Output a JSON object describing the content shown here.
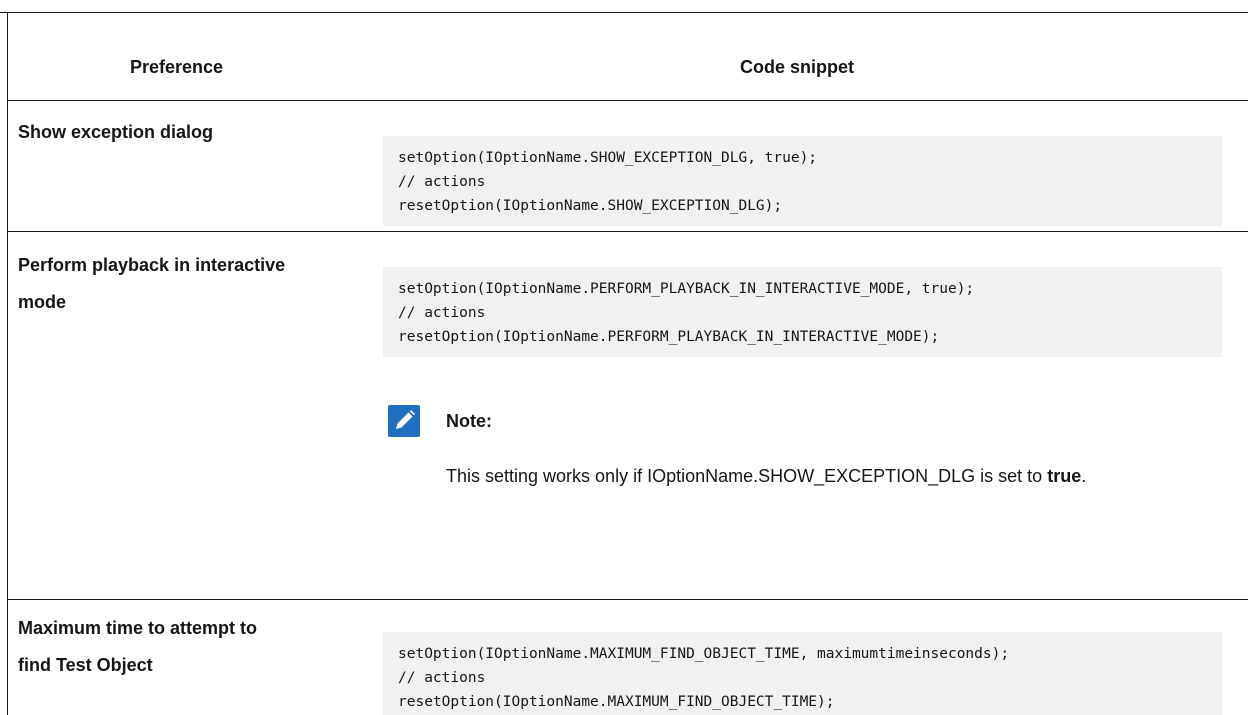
{
  "table": {
    "headers": {
      "preference": "Preference",
      "code_snippet": "Code snippet"
    },
    "rows": [
      {
        "preference": "Show exception dialog",
        "code": [
          "setOption(IOptionName.SHOW_EXCEPTION_DLG, true);",
          "// actions",
          "resetOption(IOptionName.SHOW_EXCEPTION_DLG);"
        ]
      },
      {
        "preference_lines": [
          "Perform playback in interactive",
          "mode"
        ],
        "code": [
          "setOption(IOptionName.PERFORM_PLAYBACK_IN_INTERACTIVE_MODE, true);",
          "// actions",
          "resetOption(IOptionName.PERFORM_PLAYBACK_IN_INTERACTIVE_MODE);"
        ],
        "note": {
          "icon": "pencil-note-icon",
          "label": "Note:",
          "text": "This setting works only if IOptionName.SHOW_EXCEPTION_DLG is set to",
          "bold_value": "true",
          "end": "."
        }
      },
      {
        "preference_lines": [
          "Maximum time to attempt to",
          "find Test Object"
        ],
        "code": [
          "setOption(IOptionName.MAXIMUM_FIND_OBJECT_TIME, maximumtimeinseconds);",
          "// actions",
          "resetOption(IOptionName.MAXIMUM_FIND_OBJECT_TIME);"
        ]
      }
    ]
  },
  "colors": {
    "note_icon_bg": "#1f70c1",
    "code_bg": "#f1f1f1",
    "text": "#161616"
  }
}
